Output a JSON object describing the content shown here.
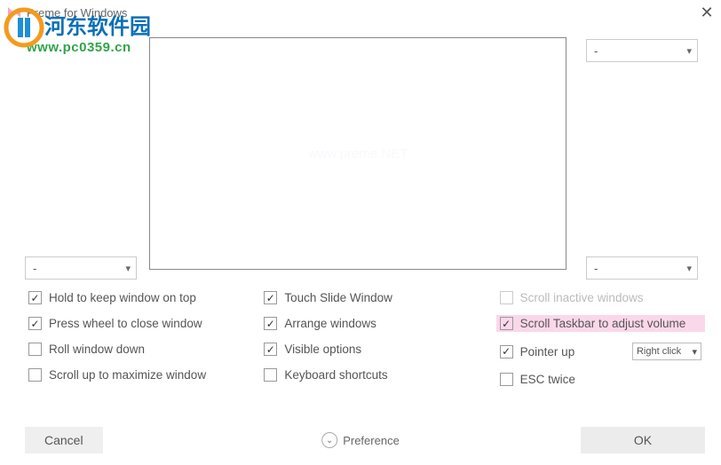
{
  "window": {
    "title": "Preme for Windows",
    "close_icon": "✕"
  },
  "watermark": {
    "text_cn": "河东软件园",
    "url": "www.pc0359.cn"
  },
  "preview": {
    "placeholder": "www.preme.NET"
  },
  "selectors": {
    "left": "-",
    "top_right": "-",
    "bottom_right": "-"
  },
  "options": {
    "col1": [
      {
        "label": "Hold to keep window on top",
        "checked": true
      },
      {
        "label": "Press wheel to close window",
        "checked": true
      },
      {
        "label": "Roll window down",
        "checked": false
      },
      {
        "label": "Scroll up to maximize window",
        "checked": false
      }
    ],
    "col2": [
      {
        "label": "Touch Slide Window",
        "checked": true
      },
      {
        "label": "Arrange windows",
        "checked": true
      },
      {
        "label": "Visible options",
        "checked": true
      },
      {
        "label": "Keyboard shortcuts",
        "checked": false
      }
    ],
    "col3": [
      {
        "label": "Scroll inactive windows",
        "checked": false,
        "disabled": true
      },
      {
        "label": "Scroll Taskbar to adjust volume",
        "checked": true,
        "highlight": true
      },
      {
        "label": "Pointer up",
        "checked": true,
        "inline_select": "Right click"
      },
      {
        "label": "ESC twice",
        "checked": false
      }
    ]
  },
  "bottom": {
    "cancel": "Cancel",
    "preference": "Preference",
    "ok": "OK"
  }
}
